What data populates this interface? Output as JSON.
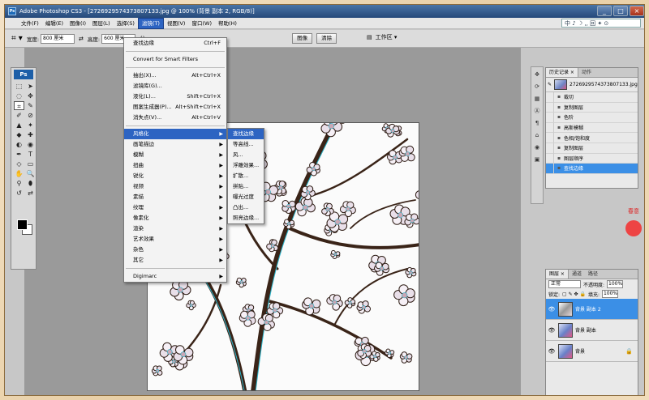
{
  "window": {
    "title": "Adobe Photoshop CS3 - [2726929574373807133.jpg @ 100% (背景 副本 2, RGB/8)]",
    "controls": [
      "_",
      "□",
      "×"
    ]
  },
  "menubar": {
    "items": [
      {
        "label": "文件(F)"
      },
      {
        "label": "编辑(E)"
      },
      {
        "label": "图像(I)"
      },
      {
        "label": "图层(L)"
      },
      {
        "label": "选择(S)"
      },
      {
        "label": "滤镜(T)"
      },
      {
        "label": "视图(V)"
      },
      {
        "label": "窗口(W)"
      },
      {
        "label": "帮助(H)"
      }
    ],
    "active_index": 5,
    "ime": "中 ♪ ☽ ,, 回 ✦ ⊙"
  },
  "options_bar": {
    "width_label": "宽度:",
    "width_value": "800 厘米",
    "swap": "⇄",
    "height_label": "高度:",
    "height_value": "600 厘米",
    "resolution_label": "分",
    "front_image_button": "图像",
    "clear_button": "清除",
    "workspace_label": "工作区 ▾"
  },
  "toolbox": {
    "logo": "Ps",
    "tools": [
      "⬚",
      "➤",
      "◌",
      "✥",
      "⌗",
      "✎",
      "✐",
      "⊘",
      "▲",
      "✦",
      "◆",
      "✚",
      "◐",
      "◉",
      "✒",
      "T",
      "◇",
      "▭",
      "✋",
      "🔍",
      "⚲",
      "⬮",
      "↺",
      "⇄"
    ]
  },
  "filter_menu": {
    "items": [
      {
        "label": "查找边缘",
        "shortcut": "Ctrl+F"
      },
      {
        "sep": true
      },
      {
        "label": "Convert for Smart Filters"
      },
      {
        "sep": true
      },
      {
        "label": "抽出(X)...",
        "shortcut": "Alt+Ctrl+X"
      },
      {
        "label": "滤镜库(G)..."
      },
      {
        "label": "液化(L)...",
        "shortcut": "Shift+Ctrl+X"
      },
      {
        "label": "图案生成器(P)...",
        "shortcut": "Alt+Shift+Ctrl+X"
      },
      {
        "label": "消失点(V)...",
        "shortcut": "Alt+Ctrl+V"
      },
      {
        "sep": true
      },
      {
        "label": "风格化",
        "submenu": true,
        "highlight": true
      },
      {
        "label": "画笔描边",
        "submenu": true
      },
      {
        "label": "模糊",
        "submenu": true
      },
      {
        "label": "扭曲",
        "submenu": true
      },
      {
        "label": "锐化",
        "submenu": true
      },
      {
        "label": "视频",
        "submenu": true
      },
      {
        "label": "素描",
        "submenu": true
      },
      {
        "label": "纹理",
        "submenu": true
      },
      {
        "label": "像素化",
        "submenu": true
      },
      {
        "label": "渲染",
        "submenu": true
      },
      {
        "label": "艺术效果",
        "submenu": true
      },
      {
        "label": "杂色",
        "submenu": true
      },
      {
        "label": "其它",
        "submenu": true
      },
      {
        "sep": true
      },
      {
        "label": "Digimarc",
        "submenu": true
      }
    ]
  },
  "stylize_submenu": {
    "items": [
      {
        "label": "查找边缘",
        "highlight": true
      },
      {
        "label": "等高线..."
      },
      {
        "label": "风..."
      },
      {
        "label": "浮雕效果..."
      },
      {
        "label": "扩散..."
      },
      {
        "label": "拼贴..."
      },
      {
        "label": "曝光过度"
      },
      {
        "label": "凸出..."
      },
      {
        "label": "照亮边缘..."
      }
    ]
  },
  "history_panel": {
    "tabs": [
      "历史记录 ×",
      "动作"
    ],
    "snapshot_name": "2726929574373807133.jpg",
    "steps": [
      "裁切",
      "复制图层",
      "色阶",
      "高斯模糊",
      "色相/饱和度",
      "复制图层",
      "图层顺序",
      "查找边缘"
    ],
    "selected_index": 7
  },
  "layers_panel": {
    "tabs": [
      "图层 ×",
      "通道",
      "路径"
    ],
    "blend_mode": "正常",
    "opacity_label": "不透明度:",
    "opacity_value": "100%",
    "lock_label": "锁定:",
    "fill_label": "填充:",
    "fill_value": "100%",
    "layers": [
      {
        "name": "背景 副本 2",
        "selected": true
      },
      {
        "name": "背景 副本",
        "selected": false
      },
      {
        "name": "背景",
        "selected": false,
        "locked": true
      }
    ]
  },
  "dock_icons": [
    "✥",
    "⟳",
    "▦",
    "Ⓐ",
    "¶",
    "⌂",
    "◉",
    "▣"
  ],
  "deco_text": "春意"
}
